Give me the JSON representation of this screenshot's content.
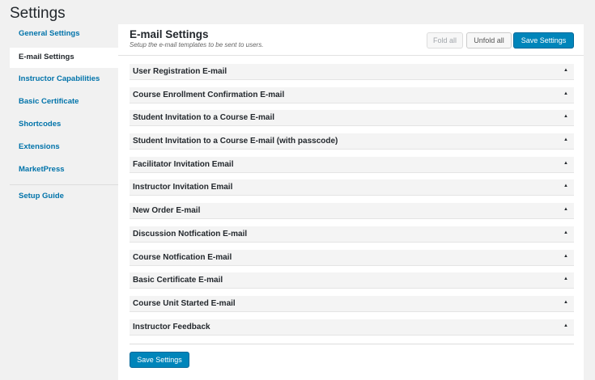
{
  "page": {
    "title": "Settings"
  },
  "sidebar": {
    "items": [
      {
        "label": "General Settings"
      },
      {
        "label": "E-mail Settings"
      },
      {
        "label": "Instructor Capabilities"
      },
      {
        "label": "Basic Certificate"
      },
      {
        "label": "Shortcodes"
      },
      {
        "label": "Extensions"
      },
      {
        "label": "MarketPress"
      },
      {
        "label": "Setup Guide"
      }
    ]
  },
  "main": {
    "title": "E-mail Settings",
    "subtitle": "Setup the e-mail templates to be sent to users.",
    "buttons": {
      "fold_all": "Fold all",
      "unfold_all": "Unfold all",
      "save_top": "Save Settings",
      "save_bottom": "Save Settings"
    },
    "sections": [
      {
        "label": "User Registration E-mail"
      },
      {
        "label": "Course Enrollment Confirmation E-mail"
      },
      {
        "label": "Student Invitation to a Course E-mail"
      },
      {
        "label": "Student Invitation to a Course E-mail (with passcode)"
      },
      {
        "label": "Facilitator Invitation Email"
      },
      {
        "label": "Instructor Invitation Email"
      },
      {
        "label": "New Order E-mail"
      },
      {
        "label": "Discussion Notfication E-mail"
      },
      {
        "label": "Course Notfication E-mail"
      },
      {
        "label": "Basic Certificate E-mail"
      },
      {
        "label": "Course Unit Started E-mail"
      },
      {
        "label": "Instructor Feedback"
      }
    ],
    "caret_glyph": "▲"
  },
  "colors": {
    "link": "#0073aa",
    "primary": "#0085ba"
  }
}
